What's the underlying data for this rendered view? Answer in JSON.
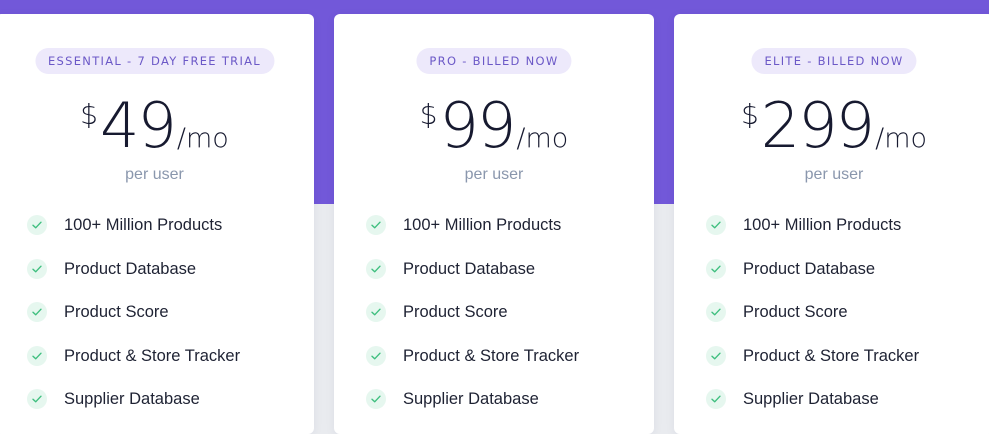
{
  "plans": [
    {
      "badge": "ESSENTIAL - 7 DAY FREE TRIAL",
      "currency": "$",
      "amount": "49",
      "period": "/mo",
      "unit": "per user",
      "features": [
        "100+ Million Products",
        "Product Database",
        "Product Score",
        "Product & Store Tracker",
        "Supplier Database"
      ]
    },
    {
      "badge": "PRO - BILLED NOW",
      "currency": "$",
      "amount": "99",
      "period": "/mo",
      "unit": "per user",
      "features": [
        "100+ Million Products",
        "Product Database",
        "Product Score",
        "Product & Store Tracker",
        "Supplier Database"
      ]
    },
    {
      "badge": "ELITE - BILLED NOW",
      "currency": "$",
      "amount": "299",
      "period": "/mo",
      "unit": "per user",
      "features": [
        "100+ Million Products",
        "Product Database",
        "Product Score",
        "Product & Store Tracker",
        "Supplier Database"
      ]
    }
  ],
  "icons": {
    "feature_check": "check-icon"
  },
  "colors": {
    "header_background": "#7258d9",
    "page_background": "#e9ebef",
    "badge_background": "#ede9fb",
    "badge_text": "#6b58c7",
    "check_color": "#3fbf7f",
    "unit_text": "#8a97ad"
  }
}
